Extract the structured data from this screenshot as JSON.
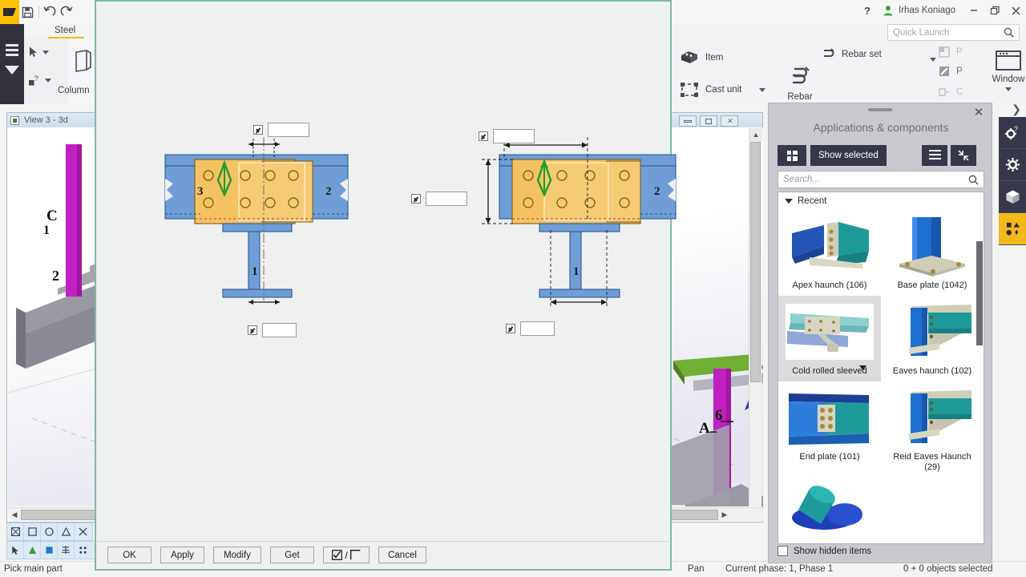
{
  "app": {
    "ribbon_tab": "Steel",
    "column_label": "Column",
    "user_name": "Irhas Koniago",
    "help_icon": "help-icon",
    "user_icon": "user-icon",
    "minimize_icon": "minimize-icon",
    "restore_icon": "restore-icon",
    "close_icon": "close-icon",
    "quick_launch_placeholder": "Quick Launch",
    "search_icon": "search-icon",
    "logo_icon": "tekla-logo-icon",
    "save_icon": "save-icon",
    "undo_icon": "undo-icon",
    "redo_icon": "redo-icon",
    "menu_icon": "hamburger-menu-icon",
    "select_icon": "cursor-arrow-icon",
    "query_icon": "query-object-icon"
  },
  "ribbon_right": {
    "item_label": "Item",
    "cast_unit_label": "Cast unit",
    "rebar_label": "Rebar",
    "rebar_set_label": "Rebar set",
    "window_label": "Window",
    "dim_items": [
      "P",
      "P",
      "C"
    ]
  },
  "view": {
    "title": "View 3 - 3d",
    "grid_labels": [
      "C",
      "1",
      "2",
      "6",
      "A"
    ]
  },
  "status": {
    "prompt": "Pick main part",
    "mode": "Pan",
    "phase": "Current phase: 1, Phase 1",
    "selection": "0 + 0 objects selected"
  },
  "panel": {
    "title": "Applications & components",
    "show_selected_label": "Show selected",
    "search_placeholder": "Search...",
    "recent_label": "Recent",
    "show_hidden_label": "Show hidden items",
    "grid_view_icon": "grid-view-icon",
    "list_view_icon": "list-view-icon",
    "collapse_icon": "collapse-icon",
    "close_icon": "close-icon",
    "components": [
      {
        "label": "Apex haunch (106)",
        "thumb": "apex-haunch",
        "selected": false
      },
      {
        "label": "Base plate (1042)",
        "thumb": "base-plate",
        "selected": false
      },
      {
        "label": "Cold rolled sleeved",
        "thumb": "cold-rolled-sleeved",
        "selected": true
      },
      {
        "label": "Eaves haunch (102)",
        "thumb": "eaves-haunch",
        "selected": false
      },
      {
        "label": "End plate (101)",
        "thumb": "end-plate",
        "selected": false
      },
      {
        "label": "Reid Eaves Haunch (29)",
        "thumb": "reid-eaves-haunch",
        "selected": false
      },
      {
        "label": "",
        "thumb": "pipe-cloud",
        "selected": false
      }
    ]
  },
  "dialog": {
    "buttons": {
      "ok": "OK",
      "apply": "Apply",
      "modify": "Modify",
      "get": "Get",
      "toggle": "/",
      "cancel": "Cancel"
    },
    "part_numbers": [
      "3",
      "2",
      "1",
      "2",
      "1"
    ],
    "fields": [
      {
        "name": "left-top-field",
        "checked": true,
        "value": ""
      },
      {
        "name": "left-bottom-field",
        "checked": true,
        "value": ""
      },
      {
        "name": "right-top-field",
        "checked": true,
        "value": ""
      },
      {
        "name": "right-left-field",
        "checked": true,
        "value": ""
      },
      {
        "name": "right-bottom-field",
        "checked": true,
        "value": ""
      }
    ]
  },
  "colors": {
    "accent": "#f5b81a",
    "panel_dark": "#37374a",
    "dialog_border": "#7fb9a3",
    "steel_blue": "#6f9ed6",
    "plate_orange": "#f5c263",
    "weld_green": "#1f9b2f",
    "column_purple": "#c020c0"
  }
}
